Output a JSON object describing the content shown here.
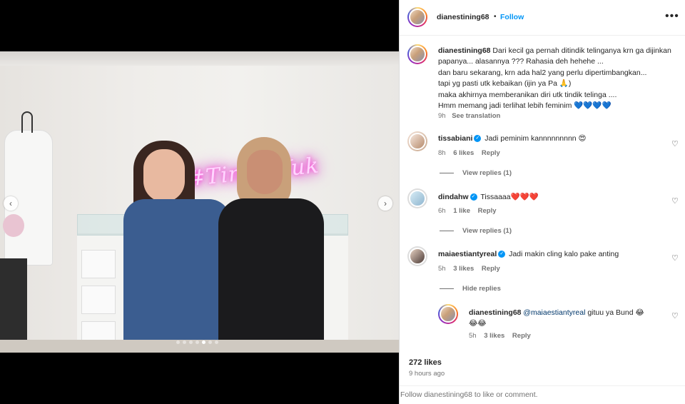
{
  "post": {
    "username": "dianestining68",
    "follow_label": "Follow",
    "separator": "•",
    "more_label": "•••",
    "neon_sign": "#TindikYuk",
    "nav_prev": "‹",
    "nav_next": "›",
    "carousel_count": 7,
    "carousel_active": 5
  },
  "caption": {
    "username": "dianestining68",
    "line1": " Dari kecil ga pernah ditindik telinganya krn ga dijinkan papanya... alasannya ??? Rahasia deh hehehe ...",
    "line2": "dan baru sekarang, krn ada hal2 yang perlu dipertimbangkan...",
    "line3": "tapi yg pasti utk kebaikan (ijin ya Pa 🙏)",
    "line4": "maka akhirnya memberanikan diri utk tindik telinga ....",
    "line5": "Hmm memang jadi terlihat lebih feminim 💙💙💙💙",
    "time": "9h",
    "see_translation": "See translation"
  },
  "comments": [
    {
      "username": "tissabiani",
      "verified": true,
      "text": "Jadi peminim kannnnnnnnn 😍",
      "time": "8h",
      "likes": "6 likes",
      "reply": "Reply",
      "view_replies": "View replies (1)"
    },
    {
      "username": "dindahw",
      "verified": true,
      "text": "Tissaaaa",
      "hearts": "❤️❤️❤️",
      "time": "6h",
      "likes": "1 like",
      "reply": "Reply",
      "view_replies": "View replies (1)"
    },
    {
      "username": "maiaestiantyreal",
      "verified": true,
      "text": "Jadi makin cling kalo pake anting",
      "time": "5h",
      "likes": "3 likes",
      "reply": "Reply",
      "hide_replies": "Hide replies"
    }
  ],
  "reply": {
    "username": "dianestining68",
    "mention": "@maiaestiantyreal",
    "text": " gituu ya Bund 😂",
    "text2": "😂😂",
    "time": "5h",
    "likes": "3 likes",
    "reply": "Reply"
  },
  "stats": {
    "likes": "272 likes",
    "ago": "9 hours ago"
  },
  "footer": {
    "text": "Follow dianestining68 to like or comment."
  },
  "icons": {
    "heart": "♡",
    "verified_check": "✓"
  },
  "colors": {
    "follow_blue": "#0095f6",
    "muted_text": "#737373",
    "text": "#262626"
  }
}
